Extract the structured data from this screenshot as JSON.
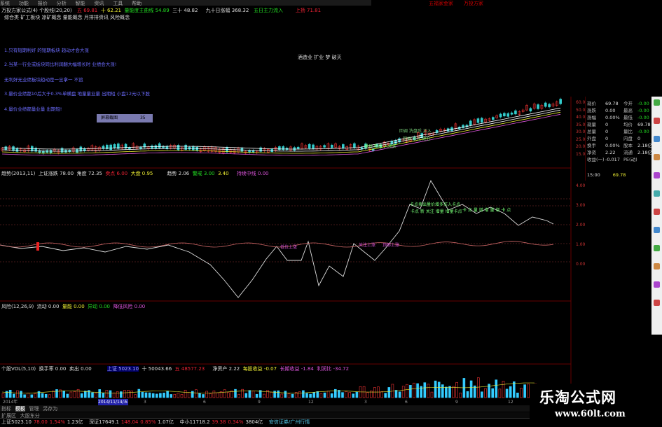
{
  "menu": [
    "系统",
    "功能",
    "报价",
    "分析",
    "智能",
    "资讯",
    "工具",
    "帮助"
  ],
  "header": {
    "title": "万投方家公式(4) 个股线(20,20)",
    "top_right": [
      "五福家金家",
      "万投方家"
    ],
    "kline_info": [
      "五 69.81",
      "十 62.21",
      "量能度主曲线 54.89",
      "三十 48.82",
      "九十日涨幅 368.32",
      "五日主力流入",
      "上扬 71.81"
    ],
    "banner": "综合类 矿工板块 凉矿概念 量能概念 月排排资讯 风险概念"
  },
  "notes": [
    "1.只有短期利好 的短期板块 趋动才会大涨",
    "2.当某一行业或板块同比利润翻大幅增长时 业绩会大涨!",
    "无利好无业绩板块趋动是一旦拿一 不追",
    "3.量价业绩都10后大于0.3%单横盘 地量量业量 出期短 小盘12元以下股",
    "4.量价业绩都量业量 出期短!"
  ],
  "note_button": {
    "label": "屏幕截图",
    "value": "35"
  },
  "annotation_center": "酒造业 扩业 梦 破灭",
  "kline_chart": {
    "type": "candlestick",
    "y_ticks": [
      "60.00",
      "50.00",
      "40.00",
      "35.00",
      "30.00",
      "25.00",
      "20.00",
      "15.00"
    ],
    "overlay_labels": [
      "回调 洗盘后 买入 ",
      "回抽 关注 建仓",
      "量价 新高 入场买 "
    ]
  },
  "quote": {
    "rows": [
      {
        "l1": "现价",
        "v1": "69.78",
        "l2": "今开",
        "v2": "-0.00"
      },
      {
        "l1": "涨跌",
        "v1": "0.00",
        "l2": "最高",
        "v2": "-0.00"
      },
      {
        "l1": "涨幅",
        "v1": "0.00%",
        "l2": "最低",
        "v2": "-0.00"
      },
      {
        "l1": "现量",
        "v1": "0",
        "l2": "均价",
        "v2": "69.78"
      },
      {
        "l1": "总量",
        "v1": "0",
        "l2": "量比",
        "v2": "-0.00"
      },
      {
        "l1": "外盘",
        "v1": "0",
        "l2": "内盘",
        "v2": "0"
      },
      {
        "l1": "换手",
        "v1": "0.00%",
        "l2": "股本",
        "v2": "2.18亿"
      },
      {
        "l1": "净资",
        "v1": "2.22",
        "l2": "流通",
        "v2": "2.18亿"
      },
      {
        "l1": "收益(一)",
        "v1": "-0.017",
        "l2": "PE(动)",
        "v2": ""
      }
    ],
    "last_row": {
      "time": "15:00",
      "price": "69.78"
    }
  },
  "indicator1": {
    "label": "趋势(2013,11)",
    "items": [
      "上证涨跌 78.00",
      "角度 72.35",
      "卖点 6.00",
      "大盘 0.95",
      "趋势 2.06",
      "警戒 3.00",
      "3.40",
      "持续中线 0.00"
    ],
    "y_ticks": [
      "4.00",
      "3.00",
      "2.00",
      "1.00",
      "0.00"
    ],
    "labels": [
      "卡点卖出量价增多买入卡点",
      "卡点 新 关注 增量 增量卡点",
      "卡 点 量 增 增 量 增 卡 点",
      "低位上涨",
      "关注上涨",
      "顶部上涨"
    ]
  },
  "indicator2": {
    "label": "风险(12,26,9)",
    "items": [
      "流动 0.00",
      "量能 0.00",
      "异动 0.00",
      "降低风险 0.00"
    ]
  },
  "indicator3": {
    "label": "个股VOL(5,10)",
    "items": [
      "换手率 0.00",
      "卖出 0.00",
      "上证 5023.10",
      "十 50043.66",
      "五 48577.23",
      "净资产 2.22",
      "每股收益 -0.07",
      "长期收益 -1.84",
      "利润比 -34.72"
    ]
  },
  "xaxis": [
    "2014年",
    "2014/11/14/五",
    "3",
    "6",
    "9",
    "12",
    "3",
    "6",
    "9",
    "12"
  ],
  "footer": {
    "tabs": [
      "指标",
      "模板",
      "管理",
      "另存为"
    ],
    "row2": [
      "扩展区",
      "大股东分"
    ],
    "stats": [
      "上证5023.10",
      "78.00",
      "1.54%",
      "1.23亿",
      "深证17649.1",
      "148.04",
      "0.85%",
      "1.07亿",
      "中小11718.2",
      "39.38",
      "0.34%",
      "3804亿",
      "安信证券/广州行情"
    ]
  },
  "watermark": {
    "title": "乐淘公式网",
    "url": "www.60lt.com"
  },
  "colors": {
    "up": "#e23",
    "down": "#2d2",
    "line_white": "#ddd",
    "line_pink": "#c66",
    "cyan": "#5ce"
  }
}
